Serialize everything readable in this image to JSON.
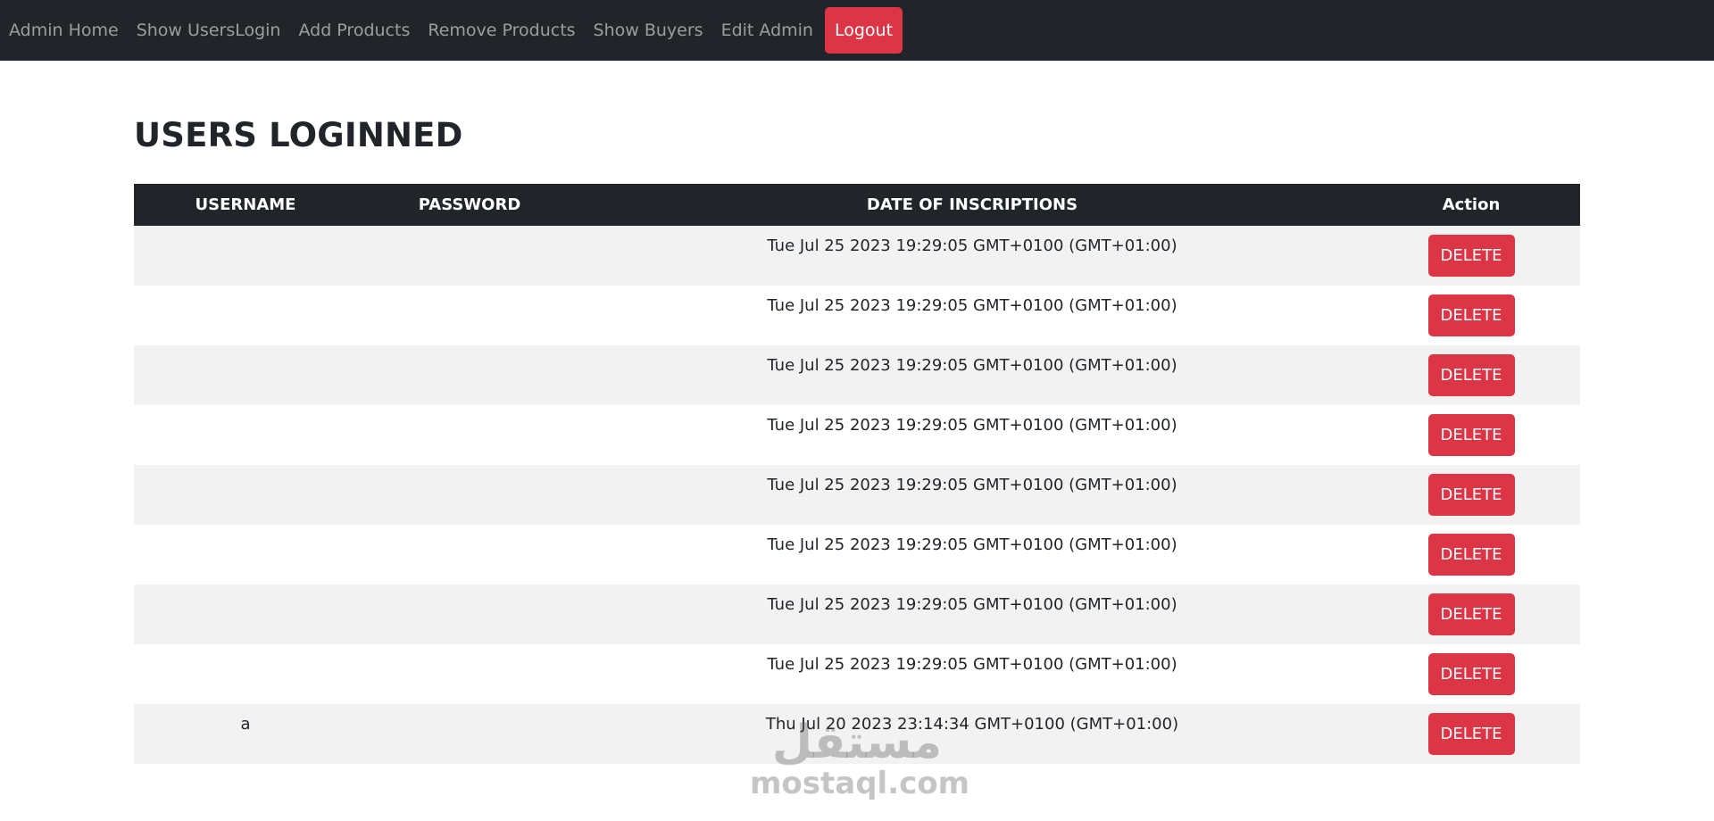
{
  "navbar": {
    "links": [
      "Admin Home",
      "Show UsersLogin",
      "Add Products",
      "Remove Products",
      "Show Buyers",
      "Edit Admin"
    ],
    "logout_label": "Logout",
    "background": "#212529",
    "logout_color": "#dc3545"
  },
  "page": {
    "title": "USERS LOGINNED"
  },
  "table": {
    "headers": [
      "USERNAME",
      "PASSWORD",
      "DATE OF INSCRIPTIONS",
      "Action"
    ],
    "rows": [
      {
        "username": "",
        "password": "",
        "date": "Tue Jul 25 2023 19:29:05 GMT+0100 (GMT+01:00)",
        "action": "DELETE"
      },
      {
        "username": "",
        "password": "",
        "date": "Tue Jul 25 2023 19:29:05 GMT+0100 (GMT+01:00)",
        "action": "DELETE"
      },
      {
        "username": "",
        "password": "",
        "date": "Tue Jul 25 2023 19:29:05 GMT+0100 (GMT+01:00)",
        "action": "DELETE"
      },
      {
        "username": "",
        "password": "",
        "date": "Tue Jul 25 2023 19:29:05 GMT+0100 (GMT+01:00)",
        "action": "DELETE"
      },
      {
        "username": "",
        "password": "",
        "date": "Tue Jul 25 2023 19:29:05 GMT+0100 (GMT+01:00)",
        "action": "DELETE"
      },
      {
        "username": "",
        "password": "",
        "date": "Tue Jul 25 2023 19:29:05 GMT+0100 (GMT+01:00)",
        "action": "DELETE"
      },
      {
        "username": "",
        "password": "",
        "date": "Tue Jul 25 2023 19:29:05 GMT+0100 (GMT+01:00)",
        "action": "DELETE"
      },
      {
        "username": "",
        "password": "",
        "date": "Tue Jul 25 2023 19:29:05 GMT+0100 (GMT+01:00)",
        "action": "DELETE"
      },
      {
        "username": "a",
        "password": "",
        "date": "Thu Jul 20 2023 23:14:34 GMT+0100 (GMT+01:00)",
        "action": "DELETE"
      }
    ],
    "header_background": "#212529",
    "stripe_color": "#f2f2f2",
    "delete_color": "#dc3545"
  },
  "watermark": {
    "mark": "مستقل",
    "text": "mostaql.com"
  }
}
